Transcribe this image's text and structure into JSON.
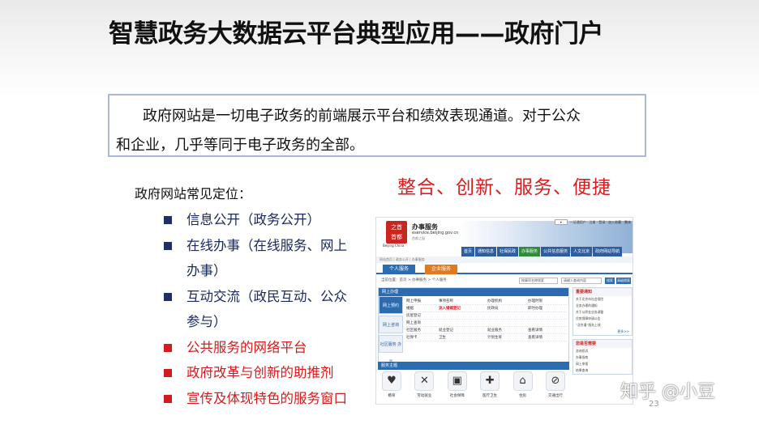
{
  "slide": {
    "title": "智慧政务大数据云平台典型应用——政府门户",
    "intro_line1": "政府网站是一切电子政务的前端展示平台和绩效表现通道。对于公众",
    "intro_line2": "和企业，几乎等同于电子政务的全部。",
    "slogan": "整合、创新、服务、便捷",
    "list_heading": "政府网站常见定位：",
    "bullets": [
      {
        "text": "信息公开（政务公开）",
        "color": "#1a2a60"
      },
      {
        "text": "在线办事（在线服务、网上",
        "color": "#1a2a60"
      },
      {
        "text": "办事）",
        "color": "#1a2a60"
      },
      {
        "text": "互动交流（政民互动、公众",
        "color": "#1a2a60"
      },
      {
        "text": "参与）",
        "color": "#1a2a60"
      },
      {
        "text": "公共服务的网络平台",
        "color": "#d41c1c"
      },
      {
        "text": "政府改革与创新的助推剂",
        "color": "#d41c1c"
      },
      {
        "text": "宣传及体现特色的服务窗口",
        "color": "#d41c1c"
      }
    ],
    "page_number": "23",
    "watermark": "知乎 @小豆"
  },
  "website": {
    "logo_text": "之首\n首都",
    "logo_sub": "Beijing China",
    "site_name": "办事服务",
    "site_url": "eservice.beijing.gov.cn",
    "site_small": "首都之窗",
    "head_links": "一证通用户 · 注册 · 登录 · 加入收藏 · 繁体",
    "nav": [
      "首页",
      "通知信息",
      "社保民政",
      "办事服务",
      "公共信息服务",
      "人文北京",
      "政府网站导航"
    ],
    "crumb": "网站首页 | 政务公开 | 办事服务",
    "tab_personal": "个人服务",
    "tab_enterprise": "企业服务",
    "location": "当前位置：首页 > 办事服务 > 个人服务",
    "search_placeholder": "按事项名称搜索",
    "search2_placeholder": "请输入查询内容",
    "search_btn": "搜索",
    "advanced_btn": "高级搜索",
    "panel_title": "网上办理",
    "side_tabs": [
      "网上预约",
      "网上咨询",
      "社区服务 办事"
    ],
    "rows": [
      {
        "a": "网上申报",
        "b": "事项名称",
        "c": "办理机构",
        "d": "办理时限"
      },
      {
        "a": "婚姻",
        "b": "流入婚姻登记",
        "c": "民政局",
        "d": "即时办理"
      },
      {
        "a": "房屋登记",
        "b": "",
        "c": "",
        "d": ""
      },
      {
        "a": "网上查询",
        "b": "",
        "c": "",
        "d": ""
      },
      {
        "a": "社区服务",
        "b": "就业登记",
        "c": "就业服务",
        "d": "查看详情"
      },
      {
        "a": "社保卡",
        "b": "卫生",
        "c": "计划生育",
        "d": "查看详情"
      }
    ],
    "services_title": "服务主题",
    "services": [
      {
        "label": "婚育",
        "glyph": "♥"
      },
      {
        "label": "劳动就业",
        "glyph": "✕"
      },
      {
        "label": "社会保障",
        "glyph": "▣"
      },
      {
        "label": "医疗卫生",
        "glyph": "✚"
      },
      {
        "label": "住房",
        "glyph": "⌂"
      },
      {
        "label": "交通出行",
        "glyph": "⊘"
      }
    ],
    "right_box1_title": "重要通知",
    "right_box1_lines": [
      "关于北京市社会保险",
      "业务办理的通知",
      "关于公积金业务调整",
      "住房保障申请公告",
      "“北京通”服务上线"
    ],
    "right_box2_title": "您是否需要",
    "right_box2_lines": [
      "咨询投诉",
      "办事指南",
      "网上申报",
      "结果查询"
    ],
    "more": "更多>>"
  }
}
